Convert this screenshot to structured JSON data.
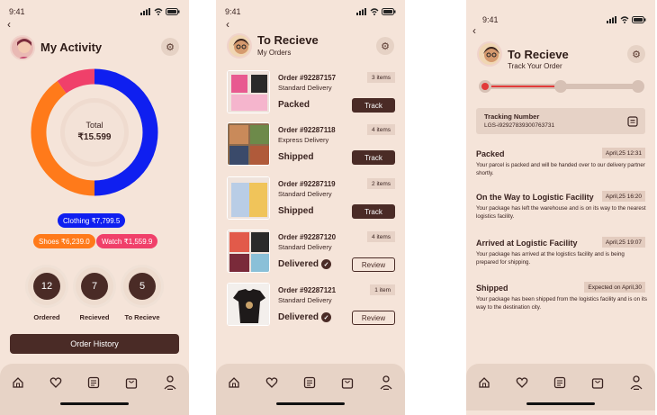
{
  "colors": {
    "accent": "#4a2b26",
    "clothing": "#0f1ff0",
    "shoes": "#ff7a1a",
    "watch": "#f0406a",
    "background": "#f5e4d9"
  },
  "status_time": "9:41",
  "screen1": {
    "title": "My Activity",
    "total_label": "Total",
    "total_value": "₹15.599",
    "segments": [
      {
        "name": "Clothing",
        "value": 7799.5,
        "label": "Clothing ₹7,799.5"
      },
      {
        "name": "Shoes",
        "value": 6239.0,
        "label": "Shoes ₹6,239.0"
      },
      {
        "name": "Watch",
        "value": 1559.9,
        "label": "Watch ₹1,559.9"
      }
    ],
    "stats": [
      {
        "value": "12",
        "label": "Ordered"
      },
      {
        "value": "7",
        "label": "Recieved"
      },
      {
        "value": "5",
        "label": "To Recieve"
      }
    ],
    "history_button": "Order History"
  },
  "screen2": {
    "title": "To Recieve",
    "subtitle": "My Orders",
    "orders": [
      {
        "id": "Order #92287157",
        "delivery": "Standard Delivery",
        "count": "3 items",
        "status": "Packed",
        "action": "Track"
      },
      {
        "id": "Order #92287118",
        "delivery": "Express Delivery",
        "count": "4 items",
        "status": "Shipped",
        "action": "Track"
      },
      {
        "id": "Order #92287119",
        "delivery": "Standard Delivery",
        "count": "2 items",
        "status": "Shipped",
        "action": "Track"
      },
      {
        "id": "Order #92287120",
        "delivery": "Standard Delivery",
        "count": "4 items",
        "status": "Delivered",
        "action": "Review"
      },
      {
        "id": "Order #92287121",
        "delivery": "Standard Delivery",
        "count": "1 item",
        "status": "Delivered",
        "action": "Review"
      }
    ]
  },
  "screen3": {
    "title": "To Recieve",
    "subtitle": "Track Your Order",
    "progress": 0.25,
    "tracking_label": "Tracking Number",
    "tracking_number": "LGS-i92927839300763731",
    "events": [
      {
        "title": "Packed",
        "date": "April,25 12:31",
        "desc": "Your parcel is packed and will be handed over to our delivery partner shortly."
      },
      {
        "title": "On the Way to Logistic Facility",
        "date": "April,25 16:20",
        "desc": "Your package has left the warehouse and is on its way to the nearest logistics facility."
      },
      {
        "title": "Arrived at Logistic Facility",
        "date": "April,25 19:07",
        "desc": "Your package has arrived at the logistics facility and is being prepared for shipping."
      },
      {
        "title": "Shipped",
        "date": "Expected on April,30",
        "desc": "Your package has been shipped from the logistics facility and is on its way to the destination city."
      }
    ]
  }
}
